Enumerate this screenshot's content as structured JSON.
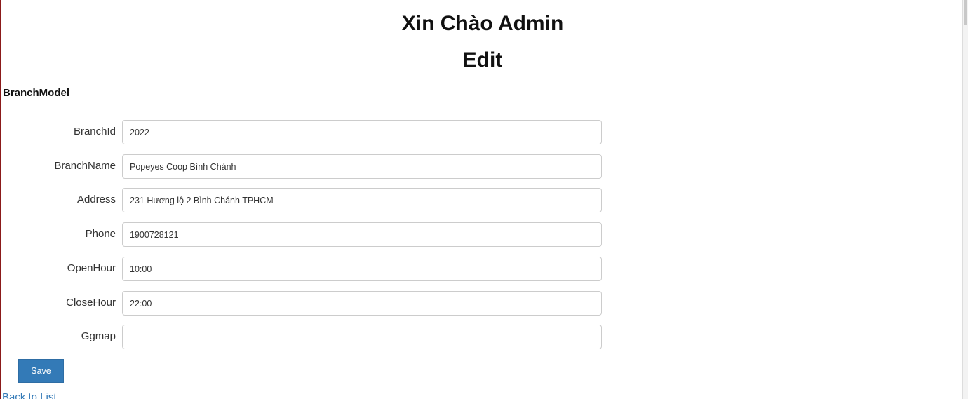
{
  "header": {
    "greeting": "Xin Chào Admin",
    "page_title": "Edit"
  },
  "section": {
    "title": "BranchModel"
  },
  "form": {
    "fields": [
      {
        "label": "BranchId",
        "value": "2022"
      },
      {
        "label": "BranchName",
        "value": "Popeyes Coop Bình Chánh"
      },
      {
        "label": "Address",
        "value": "231 Hương lộ 2 Bình Chánh TPHCM"
      },
      {
        "label": "Phone",
        "value": "1900728121"
      },
      {
        "label": "OpenHour",
        "value": "10:00"
      },
      {
        "label": "CloseHour",
        "value": "22:00"
      },
      {
        "label": "Ggmap",
        "value": ""
      }
    ],
    "save_label": "Save"
  },
  "footer": {
    "back_link": "Back to List"
  },
  "colors": {
    "primary": "#337ab7",
    "divider": "#b4b4b4",
    "input_border": "#cccccc"
  }
}
